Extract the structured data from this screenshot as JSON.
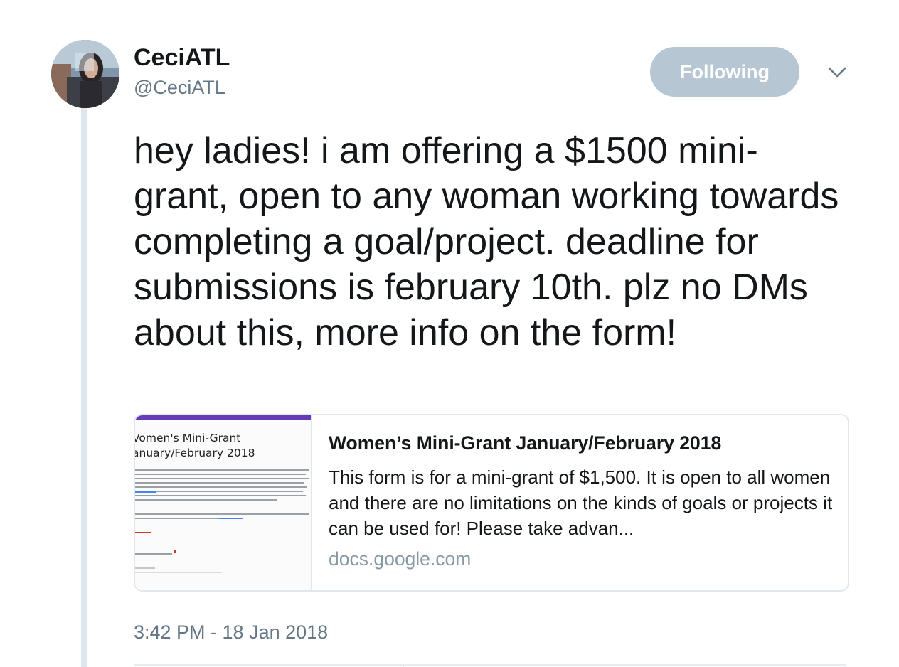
{
  "user": {
    "name": "CeciATL",
    "handle": "@CeciATL"
  },
  "follow_button": {
    "label": "Following"
  },
  "tweet": {
    "text": "hey ladies! i am offering a $1500 mini-grant, open to any woman working towards completing a goal/project. deadline for submissions is february 10th. plz no DMs about this, more info on the form!",
    "timestamp": "3:42 PM - 18 Jan 2018"
  },
  "card": {
    "image_title_line1": "Vomen's Mini-Grant",
    "image_title_line2": "anuary/February 2018",
    "title": "Women’s Mini-Grant January/February 2018",
    "description": "This form is for a mini-grant of $1,500. It is open to all women and there are no limitations on the kinds of goals or projects it can be used for! Please take advan...",
    "domain": "docs.google.com"
  },
  "colors": {
    "follow_button_bg": "#b6c6d2",
    "secondary_text": "#657786",
    "card_border": "#e1e8ed",
    "form_accent": "#673ab7"
  },
  "icons": {
    "caret": "chevron-down-icon"
  }
}
